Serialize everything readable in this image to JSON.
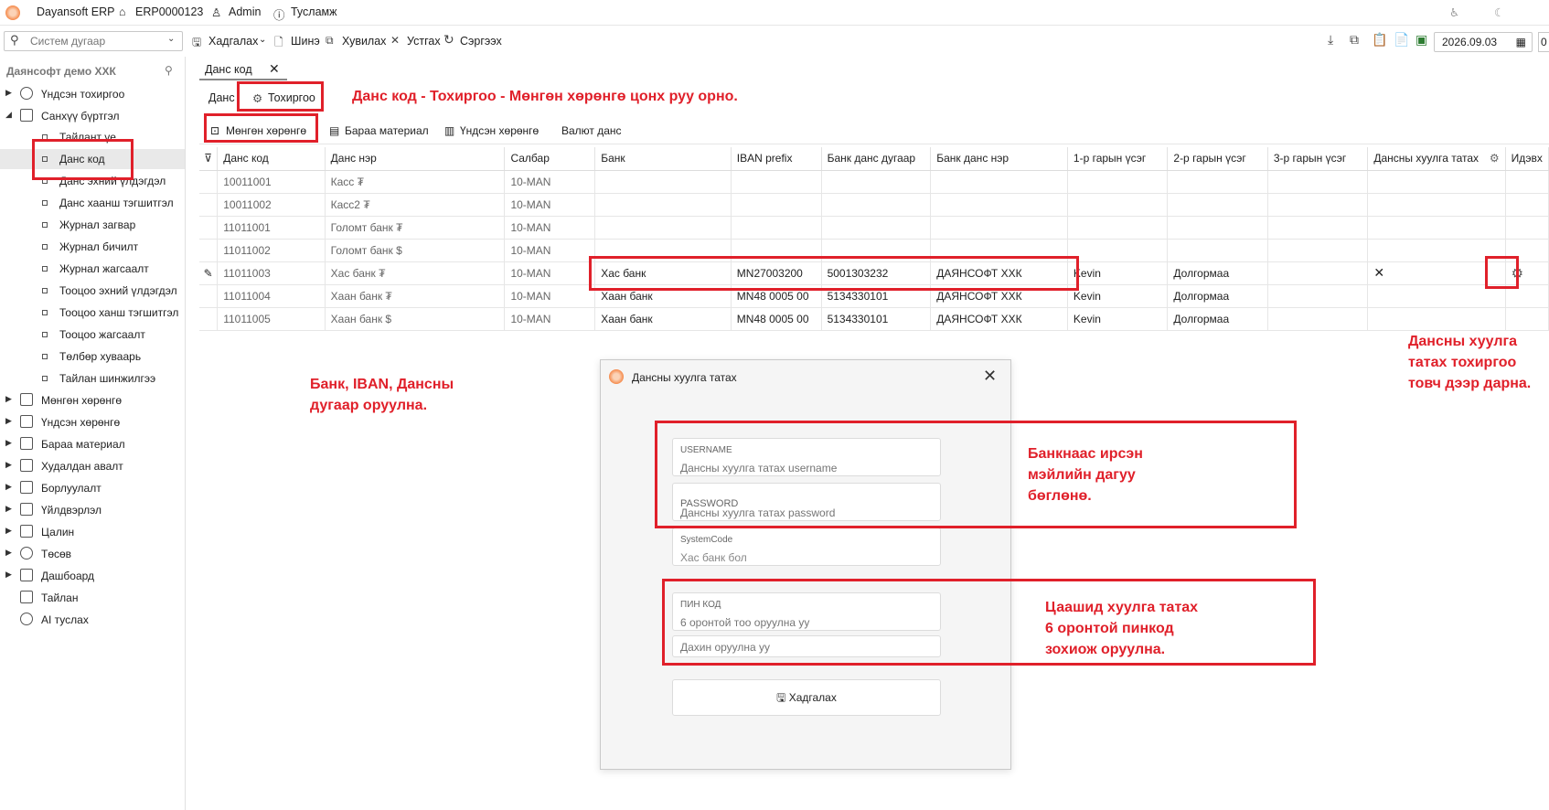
{
  "titlebar": {
    "app_name": "Dayansoft ERP",
    "company_code": "ERP0000123",
    "user": "Admin",
    "help": "Тусламж"
  },
  "toolbar": {
    "search_placeholder": "Систем дугаар",
    "save": "Хадгалах",
    "new": "Шинэ",
    "copy": "Хувилах",
    "delete": "Устгах",
    "refresh": "Сэргээх",
    "date": "2026.09.03",
    "extra": "0"
  },
  "sidebar": {
    "company": "Даянсофт демо ХХК",
    "items_top": [
      {
        "label": "Үндсэн тохиргоо",
        "arrow": "▶"
      },
      {
        "label": "Санхүү бүртгэл",
        "arrow": "◢"
      }
    ],
    "sub_items": [
      "Тайлант үе",
      "Данс код",
      "Данс эхний үлдэгдэл",
      "Данс хаанш тэгшитгэл",
      "Журнал загвар",
      "Журнал бичилт",
      "Журнал жагсаалт",
      "Тооцоо эхний үлдэгдэл",
      "Тооцоо ханш тэгшитгэл",
      "Тооцоо жагсаалт",
      "Төлбөр хуваарь",
      "Тайлан шинжилгээ"
    ],
    "items_bottom": [
      {
        "label": "Мөнгөн хөрөнгө",
        "arrow": "▶"
      },
      {
        "label": "Үндсэн хөрөнгө",
        "arrow": "▶"
      },
      {
        "label": "Бараа материал",
        "arrow": "▶"
      },
      {
        "label": "Худалдан авалт",
        "arrow": "▶"
      },
      {
        "label": "Борлуулалт",
        "arrow": "▶"
      },
      {
        "label": "Үйлдвэрлэл",
        "arrow": "▶"
      },
      {
        "label": "Цалин",
        "arrow": "▶"
      },
      {
        "label": "Төсөв",
        "arrow": "▶"
      },
      {
        "label": "Дашбоард",
        "arrow": "▶"
      },
      {
        "label": "Тайлан",
        "arrow": ""
      },
      {
        "label": "AI туслах",
        "arrow": ""
      }
    ]
  },
  "doc_tab": {
    "label": "Данс код"
  },
  "sub_tabs": {
    "account": "Данс",
    "settings": "Тохиргоо"
  },
  "inner_tabs": [
    "Мөнгөн хөрөнгө",
    "Бараа материал",
    "Үндсэн хөрөнгө",
    "Валют данс"
  ],
  "table": {
    "columns": [
      "Данс код",
      "Данс нэр",
      "Салбар",
      "Банк",
      "IBAN prefix",
      "Банк данс дугаар",
      "Банк данс нэр",
      "1-р гарын үсэг",
      "2-р гарын үсэг",
      "3-р гарын үсэг",
      "Дансны хуулга татах",
      "Идэвх"
    ],
    "rows": [
      {
        "code": "10011001",
        "name": "Касс ₮",
        "branch": "10-MAN",
        "bank": "",
        "iban": "",
        "acct_no": "",
        "acct_name": "",
        "sig1": "",
        "sig2": "",
        "sig3": "",
        "stmt": ""
      },
      {
        "code": "10011002",
        "name": "Касс2 ₮",
        "branch": "10-MAN",
        "bank": "",
        "iban": "",
        "acct_no": "",
        "acct_name": "",
        "sig1": "",
        "sig2": "",
        "sig3": "",
        "stmt": ""
      },
      {
        "code": "11011001",
        "name": "Голомт банк ₮",
        "branch": "10-MAN",
        "bank": "",
        "iban": "",
        "acct_no": "",
        "acct_name": "",
        "sig1": "",
        "sig2": "",
        "sig3": "",
        "stmt": ""
      },
      {
        "code": "11011002",
        "name": "Голомт банк $",
        "branch": "10-MAN",
        "bank": "",
        "iban": "",
        "acct_no": "",
        "acct_name": "",
        "sig1": "",
        "sig2": "",
        "sig3": "",
        "stmt": ""
      },
      {
        "code": "11011003",
        "name": "Хас банк ₮",
        "branch": "10-MAN",
        "bank": "Хас банк",
        "iban": "MN27003200",
        "acct_no": "5001303232",
        "acct_name": "ДАЯНСОФТ ХХК",
        "sig1": "Kevin",
        "sig2": "Долгормаа",
        "sig3": "",
        "stmt": "✕"
      },
      {
        "code": "11011004",
        "name": "Хаан банк ₮",
        "branch": "10-MAN",
        "bank": "Хаан банк",
        "iban": "MN48 0005 00",
        "acct_no": "5134330101",
        "acct_name": "ДАЯНСОФТ ХХК",
        "sig1": "Kevin",
        "sig2": "Долгормаа",
        "sig3": "",
        "stmt": ""
      },
      {
        "code": "11011005",
        "name": "Хаан банк $",
        "branch": "10-MAN",
        "bank": "Хаан банк",
        "iban": "MN48 0005 00",
        "acct_no": "5134330101",
        "acct_name": "ДАЯНСОФТ ХХК",
        "sig1": "Kevin",
        "sig2": "Долгормаа",
        "sig3": "",
        "stmt": ""
      }
    ]
  },
  "dialog": {
    "title": "Дансны хуулга татах",
    "username_label": "USERNAME",
    "username_placeholder": "Дансны хуулга татах username",
    "password_label": "PASSWORD",
    "password_placeholder": "Дансны хуулга татах password",
    "systemcode_label": "SystemCode",
    "systemcode_value": "Хас банк бол",
    "pin_label": "ПИН КОД",
    "pin_placeholder": "6 оронтой тоо оруулна уу",
    "pin_repeat_placeholder": "Дахин оруулна уу",
    "save": "Хадгалах"
  },
  "annotations": {
    "settings_note": "Данс код - Тохиргоо - Мөнгөн хөрөнгө цонх руу орно.",
    "bank_note": "Банк, IBAN, Дансны\nдугаар оруулна.",
    "gear_note": "Дансны хуулга\nтатах тохиргоо\nтовч дээр дарна.",
    "cred_note": "Банкнаас ирсэн\nмэйлийн дагуу\nбөглөнө.",
    "pin_note": "Цаашид хуулга татах\n6 оронтой пинкод\nзохиож оруулна."
  },
  "colors": {
    "annotation": "#e0202a",
    "logo": "#f58a4b"
  }
}
